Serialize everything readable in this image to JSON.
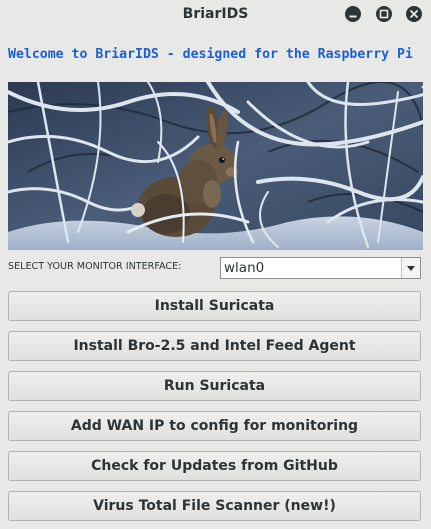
{
  "window": {
    "title": "BriarIDS",
    "minimize_icon": "minimize-icon",
    "maximize_icon": "maximize-icon",
    "close_icon": "close-icon"
  },
  "welcome_text": "Welcome to BriarIDS - designed for the Raspberry Pi",
  "banner": {
    "description": "rabbit-in-snowy-branches-painting"
  },
  "interface": {
    "label": "SELECT YOUR MONITOR INTERFACE:",
    "selected": "wlan0"
  },
  "actions": [
    {
      "label": "Install Suricata"
    },
    {
      "label": "Install Bro-2.5 and Intel Feed Agent"
    },
    {
      "label": "Run Suricata"
    },
    {
      "label": "Add WAN IP to config for monitoring"
    },
    {
      "label": "Check for Updates from GitHub"
    },
    {
      "label": "Virus Total File Scanner (new!)"
    }
  ],
  "colors": {
    "window_bg": "#e8e8e7",
    "welcome_text": "#1a5fd6",
    "title_text": "#2e3436"
  }
}
